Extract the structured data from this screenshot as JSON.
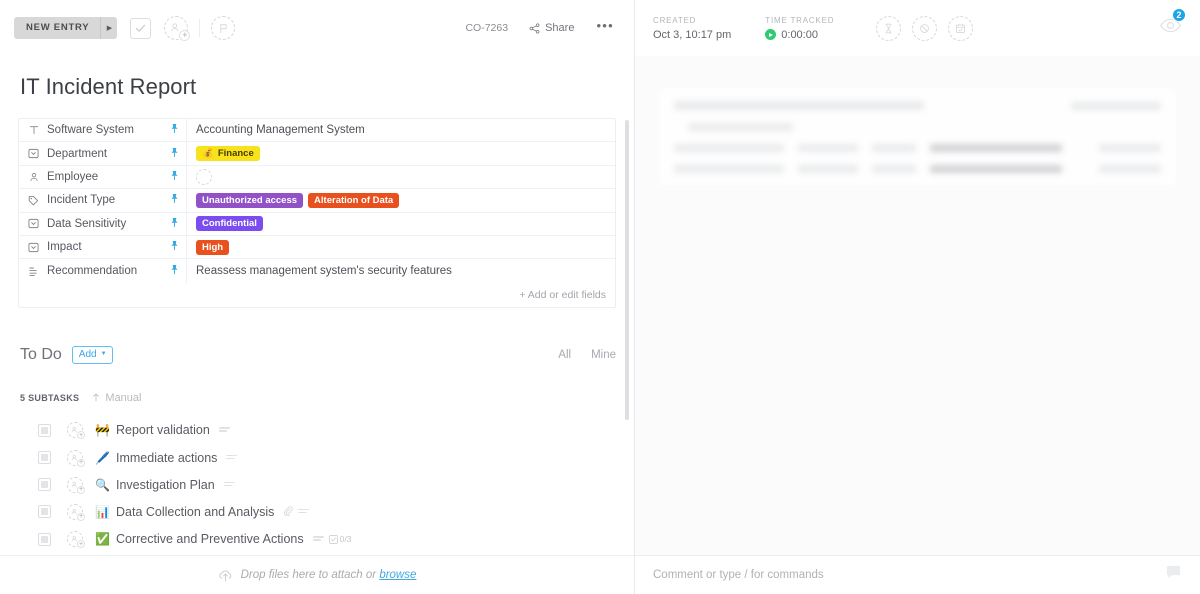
{
  "task": {
    "status_label": "NEW ENTRY",
    "task_id": "CO-7263",
    "share_label": "Share",
    "more_label": "•••",
    "title": "IT Incident Report"
  },
  "fields": {
    "rows": [
      {
        "icon": "text-icon",
        "label": "Software System",
        "type": "text",
        "value": "Accounting Management System"
      },
      {
        "icon": "dropdown-icon",
        "label": "Department",
        "type": "tags",
        "tags": [
          {
            "text": "Finance",
            "color": "#f7e21b",
            "style": "yellow",
            "emoji": "💸"
          }
        ]
      },
      {
        "icon": "person-icon",
        "label": "Employee",
        "type": "avatar",
        "value": ""
      },
      {
        "icon": "label-icon",
        "label": "Incident Type",
        "type": "tags",
        "tags": [
          {
            "text": "Unauthorized access",
            "color": "#9152c8"
          },
          {
            "text": "Alteration of Data",
            "color": "#e8501e"
          }
        ]
      },
      {
        "icon": "dropdown-icon",
        "label": "Data Sensitivity",
        "type": "tags",
        "tags": [
          {
            "text": "Confidential",
            "color": "#7b4cf0"
          }
        ]
      },
      {
        "icon": "dropdown-icon",
        "label": "Impact",
        "type": "tags",
        "tags": [
          {
            "text": "High",
            "color": "#e8501e"
          }
        ]
      },
      {
        "icon": "textlines-icon",
        "label": "Recommendation",
        "type": "text",
        "value": "Reassess management system's security features"
      }
    ],
    "add_fields_label": "+ Add or edit fields"
  },
  "todo": {
    "title": "To Do",
    "add_label": "Add",
    "filter_all": "All",
    "filter_mine": "Mine",
    "subtask_count_label": "5 SUBTASKS",
    "sort_label": "Manual",
    "subtasks": [
      {
        "emoji": "🚧",
        "name": "Report validation",
        "has_attachment": false,
        "has_description": true,
        "checklist": ""
      },
      {
        "emoji": "🖊️",
        "name": "Immediate actions",
        "has_attachment": false,
        "has_description": true,
        "checklist": ""
      },
      {
        "emoji": "🔍",
        "name": "Investigation Plan",
        "has_attachment": false,
        "has_description": true,
        "checklist": ""
      },
      {
        "emoji": "📊",
        "name": "Data Collection and Analysis",
        "has_attachment": true,
        "has_description": true,
        "checklist": ""
      },
      {
        "emoji": "✅",
        "name": "Corrective and Preventive Actions",
        "has_attachment": false,
        "has_description": true,
        "checklist": "0/3"
      }
    ]
  },
  "attachments": {
    "prompt": "Drop files here to attach or",
    "browse_label": "browse"
  },
  "details": {
    "created_label": "CREATED",
    "created_value": "Oct 3, 10:17 pm",
    "time_tracked_label": "TIME TRACKED",
    "time_tracked_value": "0:00:00",
    "watchers_count": "2"
  },
  "comment": {
    "placeholder": "Comment or type / for commands"
  },
  "colors": {
    "accent_blue": "#1aa5e8",
    "link_blue": "#41a8e0",
    "pin_blue": "#30a9e0",
    "status_gray": "#d8d8d8",
    "timer_green": "#2ecc71"
  }
}
